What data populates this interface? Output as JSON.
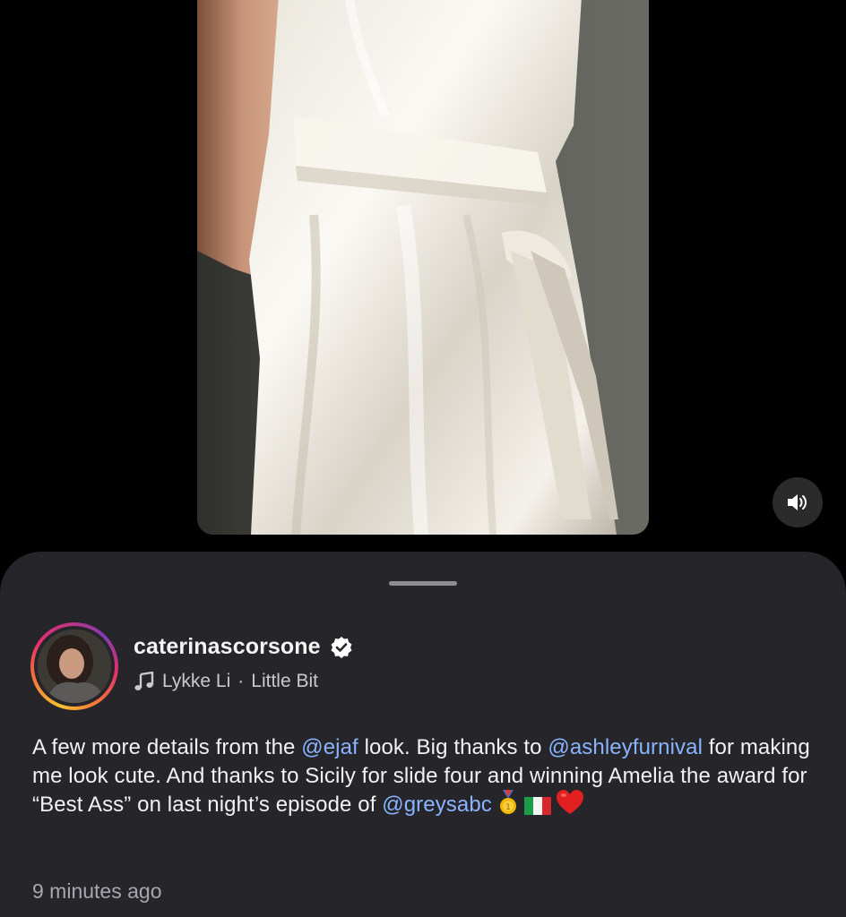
{
  "post": {
    "username": "caterinascorsone",
    "verified": true,
    "audio": {
      "artist": "Lykke Li",
      "separator": "·",
      "track": "Little Bit"
    },
    "caption": {
      "t1": "A few more details from the ",
      "m1": "@ejaf",
      "t2": " look. Big thanks to ",
      "m2": "@ashleyfurnival",
      "t3": " for making me look cute. And thanks to Sicily for slide four and winning Amelia the award for “Best Ass” on last night’s episode of ",
      "m3": "@greysabc",
      "emojis": [
        "medal-icon",
        "italy-flag-icon",
        "red-heart-icon"
      ]
    },
    "timestamp": "9 minutes ago"
  },
  "icons": {
    "mute": "speaker-icon",
    "verified": "verified-badge-icon",
    "audio": "music-note-icon"
  },
  "colors": {
    "sheet_background": "#25252a",
    "mention": "#8ab4ff",
    "verified_badge": "#ffffff"
  }
}
